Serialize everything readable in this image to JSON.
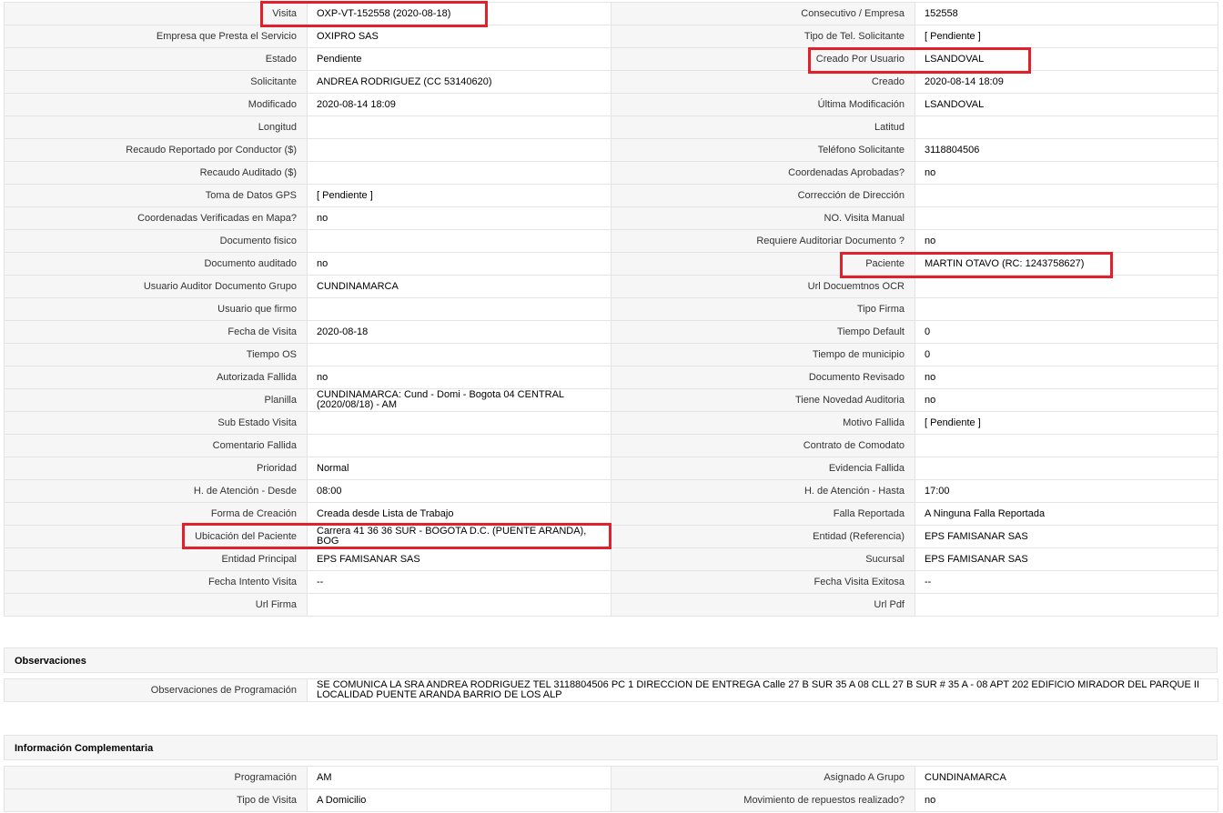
{
  "main_rows": [
    [
      "Visita",
      "OXP-VT-152558 (2020-08-18)",
      "Consecutivo / Empresa",
      "152558"
    ],
    [
      "Empresa que Presta el Servicio",
      "OXIPRO SAS",
      "Tipo de Tel. Solicitante",
      "[ Pendiente ]"
    ],
    [
      "Estado",
      "Pendiente",
      "Creado Por Usuario",
      "LSANDOVAL"
    ],
    [
      "Solicitante",
      "ANDREA RODRIGUEZ (CC 53140620)",
      "Creado",
      "2020-08-14 18:09"
    ],
    [
      "Modificado",
      "2020-08-14 18:09",
      "Última Modificación",
      "LSANDOVAL"
    ],
    [
      "Longitud",
      "",
      "Latitud",
      ""
    ],
    [
      "Recaudo Reportado por Conductor ($)",
      "",
      "Teléfono Solicitante",
      "3118804506"
    ],
    [
      "Recaudo Auditado ($)",
      "",
      "Coordenadas Aprobadas?",
      "no"
    ],
    [
      "Toma de Datos GPS",
      "[ Pendiente ]",
      "Corrección de Dirección",
      ""
    ],
    [
      "Coordenadas Verificadas en Mapa?",
      "no",
      "NO. Visita Manual",
      ""
    ],
    [
      "Documento fisico",
      "",
      "Requiere Auditoriar Documento ?",
      "no"
    ],
    [
      "Documento auditado",
      "no",
      "Paciente",
      "MARTIN OTAVO (RC: 1243758627)"
    ],
    [
      "Usuario Auditor Documento Grupo",
      "CUNDINAMARCA",
      "Url Docuemtnos OCR",
      ""
    ],
    [
      "Usuario que firmo",
      "",
      "Tipo Firma",
      ""
    ],
    [
      "Fecha de Visita",
      "2020-08-18",
      "Tiempo Default",
      "0"
    ],
    [
      "Tiempo OS",
      "",
      "Tiempo de municipio",
      "0"
    ],
    [
      "Autorizada Fallida",
      "no",
      "Documento Revisado",
      "no"
    ],
    [
      "Planilla",
      "CUNDINAMARCA: Cund - Domi - Bogota 04 CENTRAL (2020/08/18) - AM",
      "Tiene Novedad Auditoria",
      "no"
    ],
    [
      "Sub Estado Visita",
      "",
      "Motivo Fallida",
      "[ Pendiente ]"
    ],
    [
      "Comentario Fallida",
      "",
      "Contrato de Comodato",
      ""
    ],
    [
      "Prioridad",
      "Normal",
      "Evidencia Fallida",
      ""
    ],
    [
      "H. de Atención - Desde",
      "08:00",
      "H. de Atención - Hasta",
      "17:00"
    ],
    [
      "Forma de Creación",
      "Creada desde Lista de Trabajo",
      "Falla Reportada",
      "A Ninguna Falla Reportada"
    ],
    [
      "Ubicación del Paciente",
      "Carrera 41 36 36 SUR - BOGOTA D.C. (PUENTE ARANDA), BOG",
      "Entidad (Referencia)",
      "EPS FAMISANAR SAS"
    ],
    [
      "Entidad Principal",
      "EPS FAMISANAR SAS",
      "Sucursal",
      "EPS FAMISANAR SAS"
    ],
    [
      "Fecha Intento Visita",
      "--",
      "Fecha Visita Exitosa",
      "--"
    ],
    [
      "Url Firma",
      "",
      "Url Pdf",
      ""
    ]
  ],
  "observaciones": {
    "title": "Observaciones",
    "label": "Observaciones de Programación",
    "value": "SE COMUNICA LA SRA ANDREA RODRIGUEZ TEL 3118804506 PC 1 DIRECCION DE ENTREGA Calle 27 B SUR 35 A 08 CLL 27 B SUR # 35 A - 08 APT 202 EDIFICIO MIRADOR DEL PARQUE II LOCALIDAD PUENTE ARANDA BARRIO DE LOS ALP"
  },
  "complementaria": {
    "title": "Información Complementaria",
    "rows": [
      [
        "Programación",
        "AM",
        "Asignado A Grupo",
        "CUNDINAMARCA"
      ],
      [
        "Tipo de Visita",
        "A Domicilio",
        "Movimiento de repuestos realizado?",
        "no"
      ]
    ]
  },
  "highlight_color": "#e0212b"
}
